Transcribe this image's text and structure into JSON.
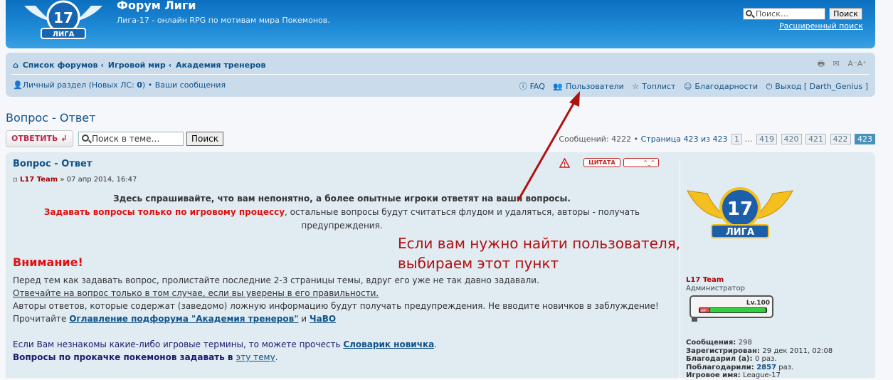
{
  "header": {
    "title": "Форум Лиги",
    "description": "Лига-17 - онлайн RPG по мотивам мира Покемонов.",
    "logo_text": "17",
    "logo_sub": "ЛИГА",
    "search_placeholder": "Поиск…",
    "search_button": "Поиск",
    "advanced_search": "Расширенный поиск"
  },
  "nav": {
    "breadcrumbs": [
      "Список форумов",
      "Игровой мир",
      "Академия тренеров"
    ],
    "breadcrumb_sep": "‹",
    "tools": [
      "print-icon",
      "email-icon",
      "font-size-icon"
    ],
    "tools_font": "A⁻A⁺",
    "personal": "Личный раздел (Новых ЛС: 0)",
    "personal_label": "Личный раздел (Новых ЛС: ",
    "personal_count": "0",
    "personal_close": ")",
    "your_posts": "Ваши сообщения",
    "links": [
      {
        "label": "FAQ",
        "icon": "faq-icon"
      },
      {
        "label": "Пользователи",
        "icon": "users-icon"
      },
      {
        "label": "Топлист",
        "icon": "star-icon"
      },
      {
        "label": "Благодарности",
        "icon": "thanks-icon"
      },
      {
        "label": "Выход [ Darth_Genius ]",
        "icon": "power-icon"
      }
    ]
  },
  "topic": {
    "title": "Вопрос - Ответ",
    "reply_button": "ОТВЕТИТЬ",
    "search_placeholder": "Поиск в теме…",
    "search_button": "Поиск",
    "pagination_text": "Сообщений: 4222 • ",
    "pagination_page": "Страница 423 из 423",
    "pages": [
      "1",
      "…",
      "419",
      "420",
      "421",
      "422",
      "423"
    ],
    "current_page": "423"
  },
  "post": {
    "title": "Вопрос - Ответ",
    "author": "L17 Team",
    "date": "» 07 апр 2014, 16:47",
    "quote_button": "ЦИТАТА",
    "thanks_button": "^_^",
    "line1": "Здесь спрашивайте, что вам непонятно, а более опытные игроки ответят на ваши вопросы.",
    "line2_red": "Задавать вопросы только по игровому процессу",
    "line2_rest": ", остальные вопросы будут считаться флудом и удаляться, авторы - получать",
    "line3": "предупреждения.",
    "attention": "Внимание!",
    "p1": "Перед тем как задавать вопрос, пролистайте последние 2-3 страницы темы, вдруг его уже не так давно задавали.",
    "p2": "Отвечайте на вопрос только в том случае, если вы уверены в его правильности.",
    "p3": "Авторы ответов, которые содержат (заведомо) ложную информацию будут получать предупреждения. Не вводите новичков в заблуждение!",
    "p4_pre": "Прочитайте ",
    "p4_link1": "Оглавление подфорума \"Академия тренеров\"",
    "p4_mid": " и ",
    "p4_link2": "ЧаВО",
    "p5_pre": "Если Вам незнакомы какие-либо игровые термины, то можете прочесть ",
    "p5_link": "Словарик новичка",
    "p5_post": ".",
    "p6_pre": "Вопросы по прокачке покемонов задавать в ",
    "p6_link": "эту тему",
    "p6_post": "."
  },
  "annotation": {
    "line1": "Если вам нужно найти пользователя,",
    "line2": "выбираем этот пункт",
    "color": "#b01010"
  },
  "profile": {
    "username": "L17 Team",
    "rank": "Администратор",
    "level": "Lv.100",
    "hp_label": "HP",
    "stats": [
      {
        "label": "Сообщения: ",
        "value": "298"
      },
      {
        "label": "Зарегистрирован: ",
        "value": "29 дек 2011, 02:08"
      },
      {
        "label": "Благодарил (а): ",
        "value": "0 раз."
      },
      {
        "label": "Поблагодарили: ",
        "value": "2857",
        "suffix": " раз."
      },
      {
        "label": "Игровое имя: ",
        "value": "League-17"
      }
    ]
  },
  "colors": {
    "header": "#1f8bd7",
    "nav_bg": "#cadceb",
    "post_bg": "#e1ebf2",
    "link": "#105289",
    "accent_red": "#e01010"
  }
}
